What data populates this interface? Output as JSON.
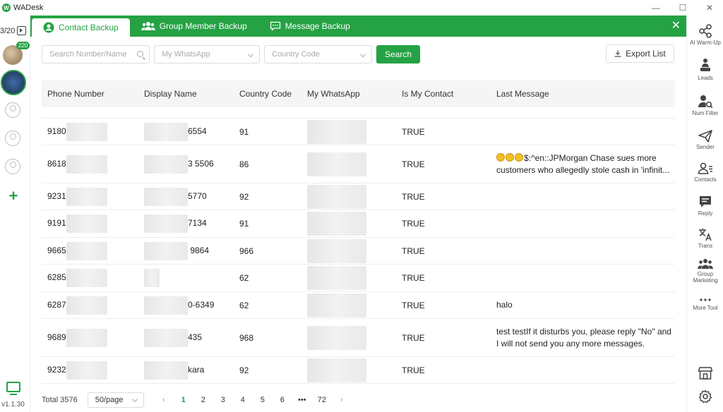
{
  "app": {
    "title": "WADesk",
    "version": "v1.1.30"
  },
  "window_controls": {
    "minimize": "—",
    "maximize": "☐",
    "close": "✕"
  },
  "accounts": {
    "count": "3/20",
    "badge": "220"
  },
  "tabs": [
    {
      "label": "Contact Backup",
      "active": true
    },
    {
      "label": "Group Member Backup",
      "active": false
    },
    {
      "label": "Message Backup",
      "active": false
    }
  ],
  "filters": {
    "search_placeholder": "Search Number/Name",
    "my_whatsapp_placeholder": "My WhatsApp",
    "country_code_placeholder": "Country Code",
    "search_button": "Search",
    "export_button": "Export List"
  },
  "table": {
    "columns": [
      "Phone Number",
      "Display Name",
      "Country Code",
      "My WhatsApp",
      "Is My Contact",
      "Last Message"
    ],
    "rows": [
      {
        "phone": "9180",
        "name": "6554",
        "cc": "91",
        "contact": "TRUE",
        "msg": ""
      },
      {
        "phone": "8618",
        "name": "3 5506",
        "cc": "86",
        "contact": "TRUE",
        "msg": "$:^en::JPMorgan Chase sues more customers who allegedly stole cash in 'infinit..."
      },
      {
        "phone": "9231",
        "name": "5770",
        "cc": "92",
        "contact": "TRUE",
        "msg": ""
      },
      {
        "phone": "9191",
        "name": "7134",
        "cc": "91",
        "contact": "TRUE",
        "msg": ""
      },
      {
        "phone": "9665",
        "name": " 9864",
        "cc": "966",
        "contact": "TRUE",
        "msg": ""
      },
      {
        "phone": "6285",
        "name": "",
        "cc": "62",
        "contact": "TRUE",
        "msg": ""
      },
      {
        "phone": "6287",
        "name": "0-6349",
        "cc": "62",
        "contact": "TRUE",
        "msg": "halo"
      },
      {
        "phone": "9689",
        "name": "435",
        "cc": "968",
        "contact": "TRUE",
        "msg": "test testIf it disturbs you, please reply \"No\" and I will not send you any more messages."
      },
      {
        "phone": "9232",
        "name": "kara",
        "cc": "92",
        "contact": "TRUE",
        "msg": ""
      }
    ]
  },
  "pagination": {
    "total": "Total 3576",
    "page_size": "50/page",
    "pages": [
      "1",
      "2",
      "3",
      "4",
      "5",
      "6",
      "•••",
      "72"
    ],
    "prev": "‹",
    "next": "›"
  },
  "tools": [
    {
      "label": "AI Warm-Up",
      "icon": "share-nodes-icon"
    },
    {
      "label": "Leads",
      "icon": "person-podium-icon"
    },
    {
      "label": "Num Filter",
      "icon": "user-search-icon"
    },
    {
      "label": "Sender",
      "icon": "paper-plane-icon"
    },
    {
      "label": "Contacts",
      "icon": "contacts-icon"
    },
    {
      "label": "Reply",
      "icon": "chat-icon"
    },
    {
      "label": "Trans",
      "icon": "translate-icon"
    },
    {
      "label": "Group Marketing",
      "icon": "group-icon"
    },
    {
      "label": "More Tool",
      "icon": "more-icon"
    }
  ],
  "colors": {
    "accent": "#25a244"
  }
}
